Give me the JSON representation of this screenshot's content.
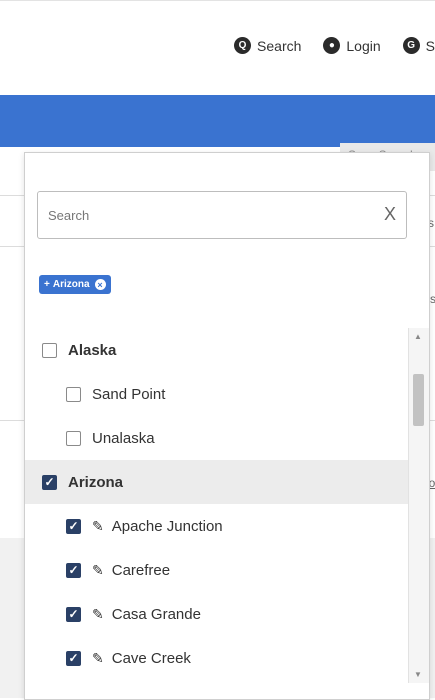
{
  "header": {
    "nav": [
      {
        "label": "Search",
        "icon": "search-icon",
        "glyph": "Q"
      },
      {
        "label": "Login",
        "icon": "user-icon",
        "glyph": "●"
      },
      {
        "label": "S",
        "icon": "g-icon",
        "glyph": "G"
      }
    ]
  },
  "background": {
    "save_search": "Save Search",
    "edge_char_1": "s",
    "edge_char_2": "rs",
    "edge_char_3": "io"
  },
  "dropdown": {
    "search_placeholder": "Search",
    "clear_label": "X",
    "selected_chips": [
      {
        "label": "Arizona"
      }
    ],
    "items": [
      {
        "type": "state",
        "label": "Alaska",
        "checked": false
      },
      {
        "type": "city",
        "label": "Sand Point",
        "checked": false
      },
      {
        "type": "city",
        "label": "Unalaska",
        "checked": false
      },
      {
        "type": "state",
        "label": "Arizona",
        "checked": true
      },
      {
        "type": "city",
        "label": "Apache Junction",
        "checked": true
      },
      {
        "type": "city",
        "label": "Carefree",
        "checked": true
      },
      {
        "type": "city",
        "label": "Casa Grande",
        "checked": true
      },
      {
        "type": "city",
        "label": "Cave Creek",
        "checked": true
      }
    ]
  },
  "colors": {
    "accent": "#3a73d0",
    "checkbox_checked": "#2a4066",
    "highlight_row": "#ececec"
  }
}
